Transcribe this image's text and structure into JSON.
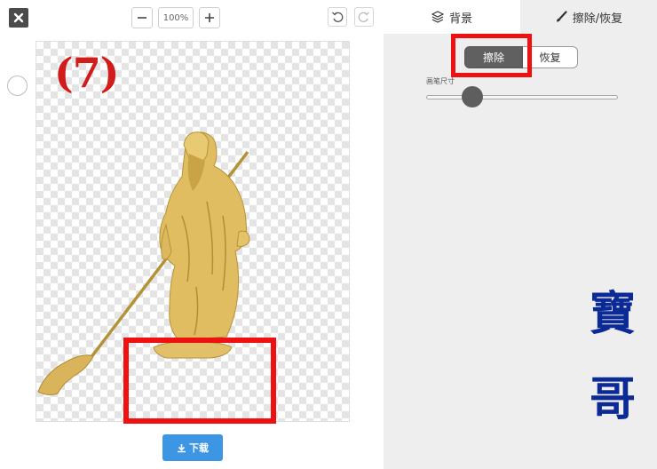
{
  "toolbar": {
    "zoom_value": "100%",
    "zoom_out_icon": "minus-icon",
    "zoom_in_icon": "plus-icon",
    "undo_icon": "undo-icon",
    "redo_icon": "redo-icon",
    "close_icon": "close-icon"
  },
  "canvas": {
    "step_label": "(7)"
  },
  "download": {
    "label": "下载",
    "icon": "download-icon"
  },
  "tabs": [
    {
      "label": "背景",
      "icon": "layers-icon",
      "active": false
    },
    {
      "label": "擦除/恢复",
      "icon": "brush-icon",
      "active": true
    }
  ],
  "mode": {
    "erase_label": "擦除",
    "restore_label": "恢复",
    "selected": "擦除"
  },
  "brush": {
    "label": "画笔尺寸",
    "size_fraction": 0.24
  },
  "watermark": {
    "chars": [
      "寶",
      "哥"
    ]
  },
  "colors": {
    "annotation_red": "#ef1111",
    "download_blue": "#3c96e4",
    "watermark_blue": "#0b2a96"
  }
}
